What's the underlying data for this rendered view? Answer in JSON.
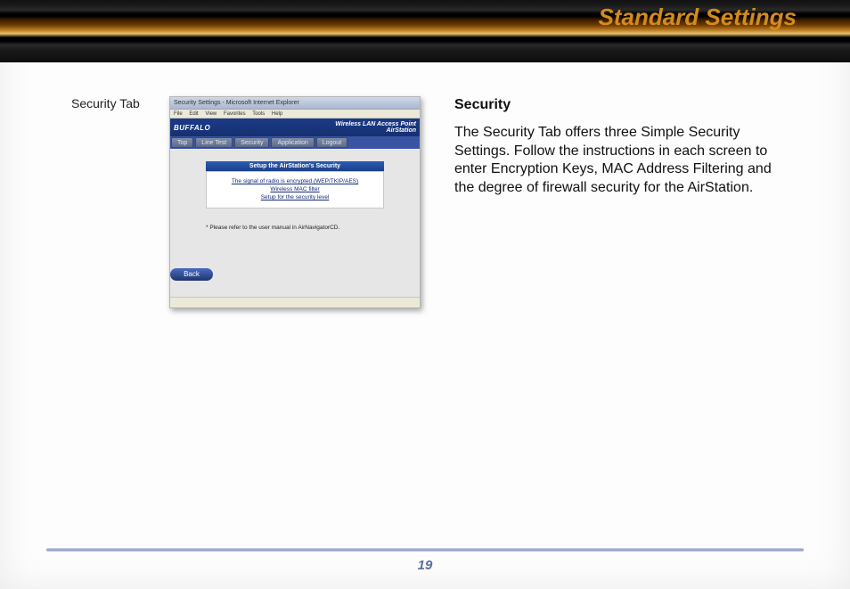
{
  "header": {
    "title": "Standard Settings"
  },
  "caption": "Security Tab",
  "screenshot": {
    "window_title": "Security Settings - Microsoft Internet Explorer",
    "menu": {
      "file": "File",
      "edit": "Edit",
      "view": "View",
      "favorites": "Favorites",
      "tools": "Tools",
      "help": "Help"
    },
    "brand_left": "BUFFALO",
    "brand_right_top": "Wireless LAN Access Point",
    "brand_right_bottom": "AirStation",
    "tabs": {
      "top": "Top",
      "lantest": "Line Test",
      "security": "Security",
      "application": "Application",
      "logout": "Logout"
    },
    "setup_title": "Setup the AirStation's Security",
    "links": {
      "l1": "The signal of radio is encrypted.(WEP/TKIP/AES)",
      "l2": "Wireless MAC filter",
      "l3": "Setup for the security level"
    },
    "note": "* Please refer to the user manual in AirNavigatorCD.",
    "back": "Back"
  },
  "section": {
    "heading": "Security",
    "body": "The Security Tab offers three Simple Security Settings. Follow the instructions in each screen to enter Encryption Keys, MAC Address Filter­ing and the degree of firewall security for the AirStation."
  },
  "page_number": "19"
}
